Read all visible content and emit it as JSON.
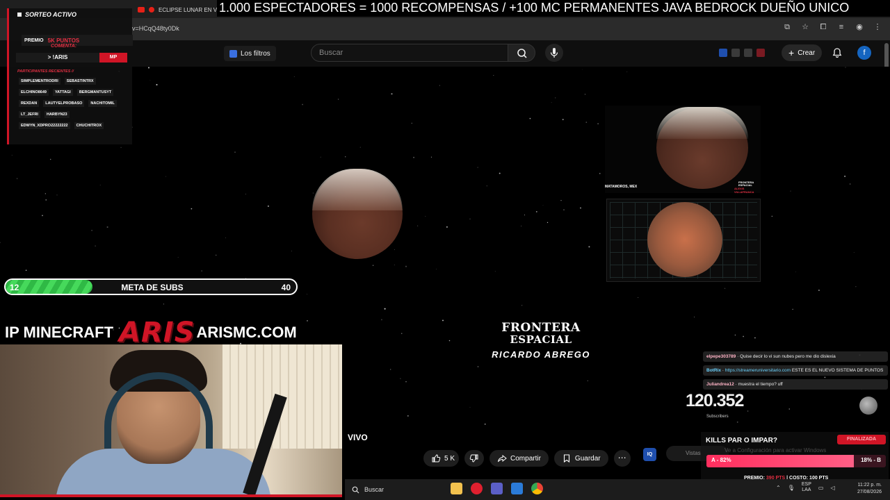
{
  "browser": {
    "tab_title": "ECLIPSE LUNAR EN VIVO:",
    "url": "v=HCqQ48ty0Dk"
  },
  "ticker": "1.000 ESPECTADORES = 1000 RECOMPENSAS / +100 MC PERMANENTES JAVA BEDROCK DUEÑO UNICO",
  "youtube": {
    "filters_label": "Los filtros",
    "search_placeholder": "Buscar",
    "create_label": "Crear",
    "avatar_letter": "f"
  },
  "giveaway": {
    "title": "SORTEO ACTIVO",
    "prize_label": "PREMIO",
    "prize_value": "5K PUNTOS",
    "comment_label": "COMENTA:",
    "keyword": "> !ARIS",
    "badge": "MP",
    "recent_label": "PARTICIPANTES RECIENTES //",
    "participants": [
      "SIMPLEMENTRODRI",
      "SEBASTINTRX",
      "ELCHINO8649",
      "YATTAGI",
      "BERGMANTUSYT",
      "REXDAN",
      "LAUTYELPROBASO",
      "NACHITOMIL",
      "LT_JEFRI",
      "HARBYN23",
      "EDWYN_XDPRO22222222",
      "CHUCHITROX"
    ]
  },
  "subs_goal": {
    "current": "12",
    "label": "META DE SUBS",
    "goal": "40",
    "fraction": 0.3
  },
  "ip": {
    "label": "IP MINECRAFT",
    "logo": "ARIS",
    "domain": "ARISMC.COM"
  },
  "video": {
    "brand_line1": "FRONTERA",
    "brand_line2": "ESPACIAL",
    "presenter": "RICARDO ABREGO",
    "inset_location": "MATAMOROS, MEX",
    "inset_brand_1": "FRONTERA",
    "inset_brand_2": "ESPACIAL",
    "inset_credit": "ALEXIS VILLAFRANCA"
  },
  "video_meta": {
    "status": "VIVO",
    "likes": "5 K",
    "share_label": "Compartir",
    "save_label": "Guardar",
    "more": "⋯",
    "iq_badge": "IQ",
    "views_label": "Vistas"
  },
  "chat": [
    {
      "user": "elpepe303789",
      "text": "Quise decir lo vi sun nubes pero me dio dislexia",
      "bot": false
    },
    {
      "user": "BotRix",
      "text": "ESTE ES EL NUEVO SISTEMA DE PUNTOS",
      "link": "https://streameruniversitario.com",
      "bot": true
    },
    {
      "user": "Juliandrea12",
      "text": "muestra el tiempo? uff",
      "bot": false
    }
  ],
  "counter": {
    "value": "120.352",
    "caption": "Subscribers"
  },
  "poll": {
    "question": "KILLS PAR O IMPAR?",
    "status": "FINALIZADA",
    "watermark": "Ve a Configuración para activar Windows",
    "option_a": "A - 82%",
    "option_b": "18% - B",
    "fill_fraction": 0.82,
    "footer_prize_label": "PREMIO:",
    "footer_prize_value": "390 PTS",
    "footer_cost": "| COSTO: 100 PTS"
  },
  "taskbar": {
    "search_placeholder": "Buscar",
    "lang_1": "ESP",
    "lang_2": "LAA",
    "time": "11:22 p. m.",
    "date": "27/08/2026"
  },
  "colors": {
    "brand_red": "#d01526",
    "goal_green": "#46d95b",
    "poll_pink": "#ff2e5e"
  }
}
